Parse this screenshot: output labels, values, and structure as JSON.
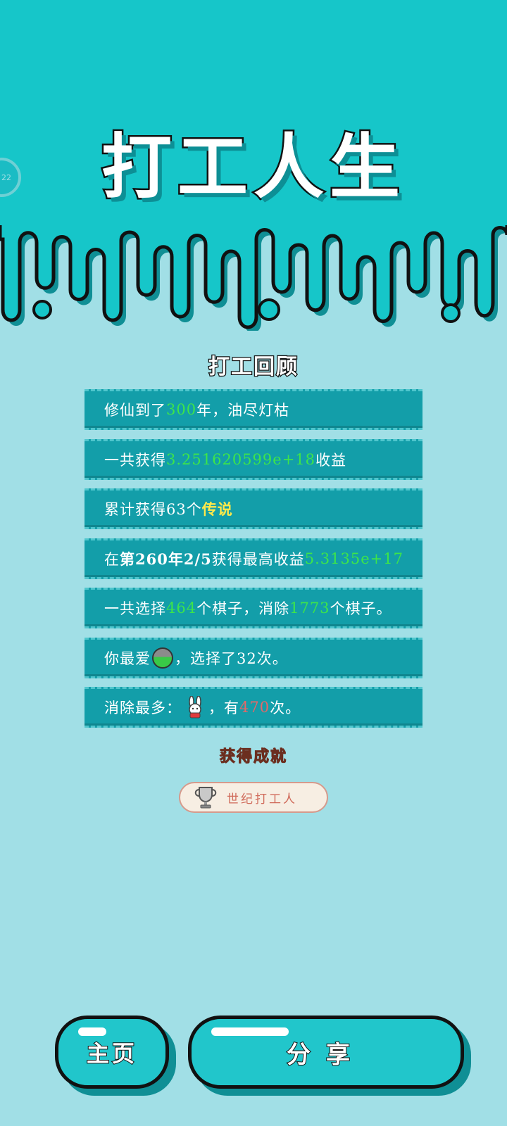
{
  "header": {
    "title": "打工人生",
    "side_badge_text": "22",
    "bg_color": "#16c6c9"
  },
  "review": {
    "title": "打工回顾",
    "rows": [
      {
        "parts": [
          {
            "t": "修仙到了"
          },
          {
            "t": "300",
            "c": "g"
          },
          {
            "t": "年，油尽灯枯"
          }
        ]
      },
      {
        "parts": [
          {
            "t": "一共获得"
          },
          {
            "t": "3.251620599e+18",
            "c": "g"
          },
          {
            "t": "收益"
          }
        ]
      },
      {
        "parts": [
          {
            "t": "累计获得63个"
          },
          {
            "t": "传说",
            "c": "y"
          }
        ]
      },
      {
        "parts": [
          {
            "t": "在 "
          },
          {
            "t": "第260年2/5",
            "c": "b"
          },
          {
            "t": " 获得最高收益"
          },
          {
            "t": "5.3135e+17",
            "c": "g"
          }
        ]
      },
      {
        "parts": [
          {
            "t": "一共选择"
          },
          {
            "t": "464",
            "c": "g"
          },
          {
            "t": "个棋子，消除"
          },
          {
            "t": "1773",
            "c": "g"
          },
          {
            "t": "个棋子。"
          }
        ]
      },
      {
        "parts": [
          {
            "t": "你最爱"
          },
          {
            "icon": "green-slime-icon"
          },
          {
            "t": "，选择了32次。"
          }
        ]
      },
      {
        "parts": [
          {
            "t": "消除最多："
          },
          {
            "icon": "bunny-icon"
          },
          {
            "t": "，有"
          },
          {
            "t": "470",
            "c": "r"
          },
          {
            "t": "次。"
          }
        ]
      }
    ]
  },
  "achievement": {
    "title": "获得成就",
    "badge_label": "世纪打工人",
    "badge_icon": "trophy-icon"
  },
  "buttons": {
    "home_label": "主页",
    "share_label": "分享"
  },
  "colors": {
    "accent": "#21c6cb",
    "row_bg": "#139ea9",
    "highlight_green": "#3de54a",
    "highlight_yellow": "#ffe94a",
    "highlight_red": "#e56767"
  }
}
